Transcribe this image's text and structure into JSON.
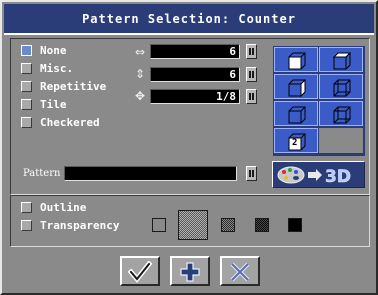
{
  "dialog": {
    "title": "Pattern Selection: Counter"
  },
  "pattern_types": [
    {
      "label": "None",
      "checked": true
    },
    {
      "label": "Misc.",
      "checked": false
    },
    {
      "label": "Repetitive",
      "checked": false
    },
    {
      "label": "Tile",
      "checked": false
    },
    {
      "label": "Checkered",
      "checked": false
    }
  ],
  "params": {
    "horizontal": {
      "icon": "horizontal-arrows-icon",
      "value": "6"
    },
    "vertical": {
      "icon": "vertical-arrows-icon",
      "value": "6"
    },
    "both": {
      "icon": "four-way-arrows-icon",
      "value": "1/8"
    }
  },
  "grid_cells": [
    {
      "icon": "cube-front-icon"
    },
    {
      "icon": "cube-top-right-icon"
    },
    {
      "icon": "cube-right-icon"
    },
    {
      "icon": "cube-wire-icon"
    },
    {
      "icon": "cube-left-icon"
    },
    {
      "icon": "cube-back-icon"
    },
    {
      "icon": "cube-2-icon",
      "text": "2"
    }
  ],
  "pattern": {
    "label": "Pattern",
    "value": ""
  },
  "options": {
    "outline": {
      "label": "Outline",
      "checked": false
    },
    "transparency": {
      "label": "Transparency",
      "checked": false
    }
  },
  "colors": {
    "title_bg": "#2a3d78",
    "selected_cell": "#3a5bc8",
    "checkbox_on": "#6a8ad0"
  },
  "buttons": {
    "ok": {
      "icon": "checkmark-icon"
    },
    "add": {
      "icon": "plus-icon"
    },
    "cancel": {
      "icon": "x-icon"
    }
  }
}
